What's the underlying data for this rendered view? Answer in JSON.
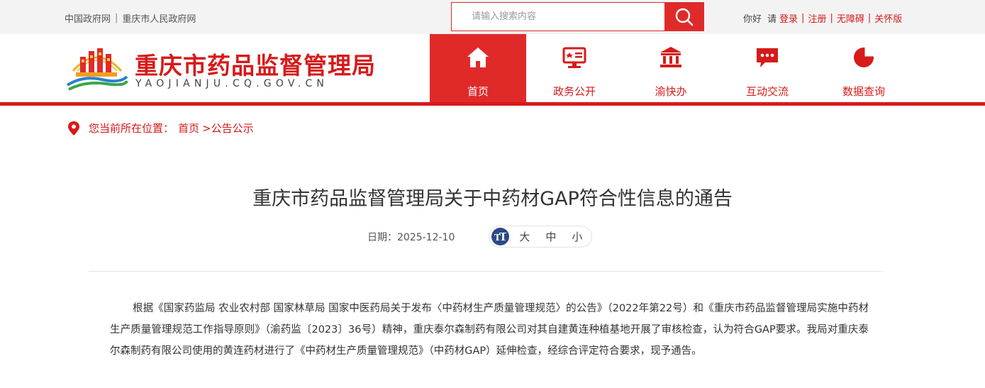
{
  "topbar": {
    "gov_links": [
      "中国政府网",
      "重庆市人民政府网"
    ],
    "search": {
      "placeholder": "请输入搜索内容"
    },
    "greeting": "你好",
    "please": "请",
    "user_links": [
      "登录",
      "注册",
      "无障碍",
      "关怀版"
    ]
  },
  "header": {
    "site_title": "重庆市药品监督管理局",
    "site_domain": "YAOJIANJU.CQ.GOV.CN"
  },
  "nav": {
    "items": [
      {
        "label": "首页",
        "icon": "home-icon",
        "active": true
      },
      {
        "label": "政务公开",
        "icon": "monitor-icon",
        "active": false
      },
      {
        "label": "渝快办",
        "icon": "building-icon",
        "active": false
      },
      {
        "label": "互动交流",
        "icon": "chat-icon",
        "active": false
      },
      {
        "label": "数据查询",
        "icon": "pie-chart-icon",
        "active": false
      }
    ]
  },
  "breadcrumb": {
    "label": "您当前所在位置：",
    "items": [
      "首页",
      ">公告公示"
    ]
  },
  "article": {
    "title": "重庆市药品监督管理局关于中药材GAP符合性信息的通告",
    "date": "日期：2025-12-10",
    "font_sizes": [
      "大",
      "中",
      "小"
    ],
    "paragraph": "根据《国家药监局 农业农村部 国家林草局 国家中医药局关于发布〈中药材生产质量管理规范〉的公告》（2022年第22号）和《重庆市药品监督管理局实施中药材生产质量管理规范工作指导原则》（渝药监〔2023〕36号）精神，重庆泰尔森制药有限公司对其自建黄连种植基地开展了审核检查，认为符合GAP要求。我局对重庆泰尔森制药有限公司使用的黄连药材进行了《中药材生产质量管理规范》（中药材GAP）延伸检查，经综合评定符合要求，现予通告。"
  },
  "colors": {
    "brand_red": "#d71a1a",
    "accent_red": "#e02a2a",
    "font_icon_blue": "#2b4a86"
  }
}
